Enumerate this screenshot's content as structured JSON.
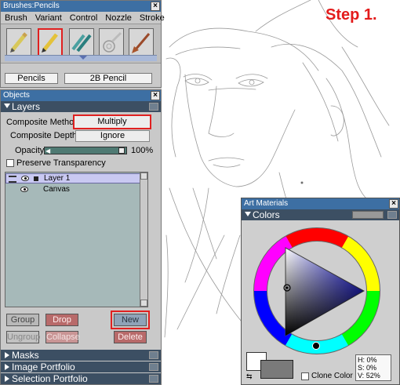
{
  "step_label": "Step 1.",
  "brushes": {
    "title": "Brushes:Pencils",
    "menu": [
      "Brush",
      "Variant",
      "Control",
      "Nozzle",
      "Stroke"
    ],
    "category": "Pencils",
    "variant": "2B Pencil",
    "icons": [
      "pencil-icon",
      "pencil-icon",
      "pencil-icon",
      "airbrush-icon",
      "paintbrush-icon"
    ]
  },
  "objects": {
    "title": "Objects",
    "layers_header": "Layers",
    "composite_method_label": "Composite Method",
    "composite_method_value": "Multiply",
    "composite_depth_label": "Composite Depth",
    "composite_depth_value": "Ignore",
    "opacity_label": "Opacity",
    "opacity_value": "100%",
    "preserve_transparency": "Preserve Transparency",
    "layers": [
      "Layer 1",
      "Canvas"
    ],
    "buttons": {
      "group": "Group",
      "drop": "Drop",
      "new": "New",
      "ungroup": "Ungroup",
      "collapse": "Collapse",
      "delete": "Delete"
    },
    "collapsed_sections": [
      "Masks",
      "Image Portfolio",
      "Selection Portfolio"
    ]
  },
  "art_materials": {
    "title": "Art Materials",
    "colors_header": "Colors",
    "clone_color": "Clone Color",
    "h_label": "H:",
    "h_value": "0%",
    "s_label": "S:",
    "s_value": "0%",
    "v_label": "V:",
    "v_value": "52%"
  },
  "colors": {
    "highlight": "#e02020",
    "panel": "#c9c9c9",
    "header": "#3c4f63"
  }
}
